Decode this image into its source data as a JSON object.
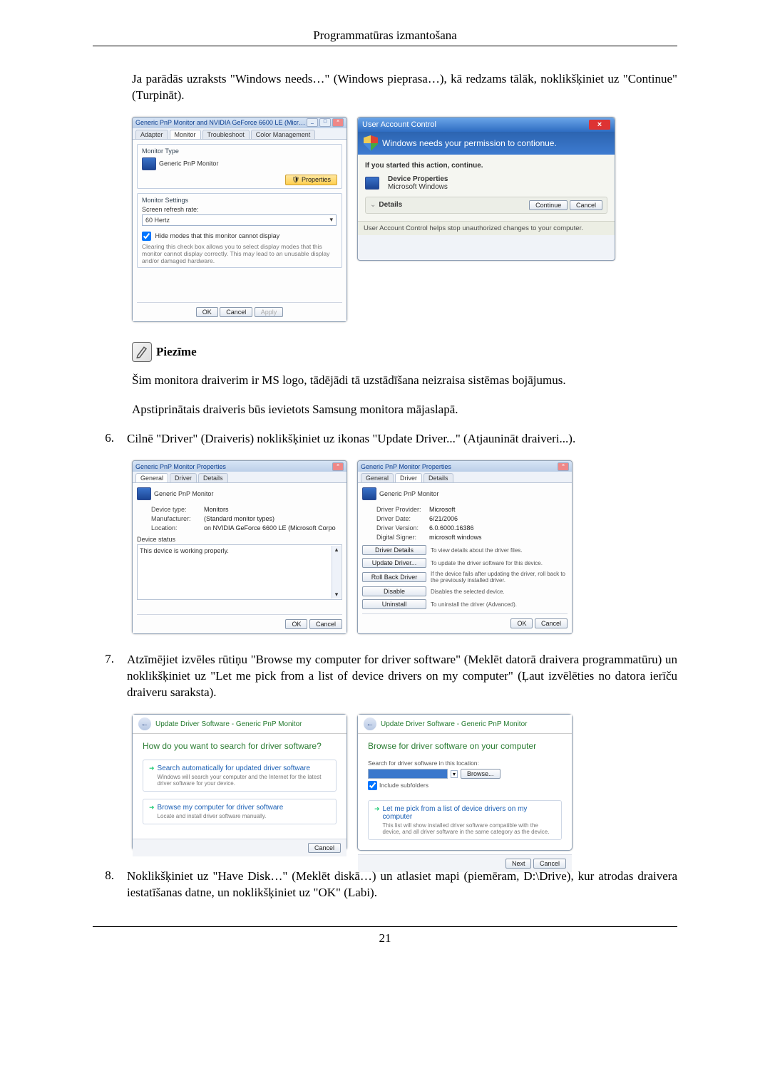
{
  "header": {
    "title": "Programmatūras izmantošana"
  },
  "intro": "Ja parādās uzraksts \"Windows needs…\" (Windows pieprasa…), kā redzams tālāk, noklikšķiniet uz \"Continue\" (Turpināt).",
  "monitorSettings": {
    "title": "Generic PnP Monitor and NVIDIA GeForce 6600 LE (Microsoft Co...",
    "tabs": [
      "Adapter",
      "Monitor",
      "Troubleshoot",
      "Color Management"
    ],
    "activeTab": "Monitor",
    "typeGroup": "Monitor Type",
    "deviceName": "Generic PnP Monitor",
    "propertiesBtn": "Properties",
    "settingsGroup": "Monitor Settings",
    "refreshLabel": "Screen refresh rate:",
    "refreshValue": "60 Hertz",
    "hideModesLabel": "Hide modes that this monitor cannot display",
    "hideModesHelp": "Clearing this check box allows you to select display modes that this monitor cannot display correctly. This may lead to an unusable display and/or damaged hardware.",
    "ok": "OK",
    "cancel": "Cancel",
    "apply": "Apply"
  },
  "uac": {
    "windowTitle": "User Account Control",
    "headerText": "Windows needs your permission to contionue.",
    "ifStarted": "If you started this action, continue.",
    "line1": "Device Properties",
    "line2": "Microsoft Windows",
    "details": "Details",
    "continue": "Continue",
    "cancel": "Cancel",
    "footer": "User Account Control helps stop unauthorized changes to your computer."
  },
  "note": {
    "label": "Piezīme",
    "p1": "Šim monitora draiverim ir MS logo, tādējādi tā uzstādīšana neizraisa sistēmas bojājumus.",
    "p2": "Apstiprinātais draiveris būs ievietots Samsung monitora mājaslapā."
  },
  "step6": {
    "num": "6.",
    "text": "Cilnē \"Driver\" (Draiveris) noklikšķiniet uz ikonas \"Update Driver...\" (Atjaunināt draiveri...)."
  },
  "propsGeneral": {
    "title": "Generic PnP Monitor Properties",
    "tabs": [
      "General",
      "Driver",
      "Details"
    ],
    "active": "General",
    "name": "Generic PnP Monitor",
    "rows": [
      {
        "k": "Device type:",
        "v": "Monitors"
      },
      {
        "k": "Manufacturer:",
        "v": "(Standard monitor types)"
      },
      {
        "k": "Location:",
        "v": "on NVIDIA GeForce 6600 LE (Microsoft Corpo"
      }
    ],
    "statusLabel": "Device status",
    "statusText": "This device is working properly.",
    "ok": "OK",
    "cancel": "Cancel"
  },
  "propsDriver": {
    "title": "Generic PnP Monitor Properties",
    "tabs": [
      "General",
      "Driver",
      "Details"
    ],
    "active": "Driver",
    "name": "Generic PnP Monitor",
    "rows": [
      {
        "k": "Driver Provider:",
        "v": "Microsoft"
      },
      {
        "k": "Driver Date:",
        "v": "6/21/2006"
      },
      {
        "k": "Driver Version:",
        "v": "6.0.6000.16386"
      },
      {
        "k": "Digital Signer:",
        "v": "microsoft windows"
      }
    ],
    "btnDetails": "Driver Details",
    "btnDetailsTxt": "To view details about the driver files.",
    "btnUpdate": "Update Driver...",
    "btnUpdateTxt": "To update the driver software for this device.",
    "btnRollback": "Roll Back Driver",
    "btnRollbackTxt": "If the device fails after updating the driver, roll back to the previously installed driver.",
    "btnDisable": "Disable",
    "btnDisableTxt": "Disables the selected device.",
    "btnUninstall": "Uninstall",
    "btnUninstallTxt": "To uninstall the driver (Advanced).",
    "ok": "OK",
    "cancel": "Cancel"
  },
  "step7": {
    "num": "7.",
    "text": "Atzīmējiet izvēles rūtiņu \"Browse my computer for driver software\" (Meklēt datorā draivera programmatūru) un noklikšķiniet uz \"Let me pick from a list of device drivers on my computer\" (Ļaut izvēlēties no datora ierīču draiveru saraksta)."
  },
  "wizard1": {
    "breadcrumb": "Update Driver Software - Generic PnP Monitor",
    "question": "How do you want to search for driver software?",
    "opt1Title": "Search automatically for updated driver software",
    "opt1Sub": "Windows will search your computer and the Internet for the latest driver software for your device.",
    "opt2Title": "Browse my computer for driver software",
    "opt2Sub": "Locate and install driver software manually.",
    "cancel": "Cancel"
  },
  "wizard2": {
    "breadcrumb": "Update Driver Software - Generic PnP Monitor",
    "heading": "Browse for driver software on your computer",
    "searchLabel": "Search for driver software in this location:",
    "browse": "Browse...",
    "includeSub": "Include subfolders",
    "optTitle": "Let me pick from a list of device drivers on my computer",
    "optSub": "This list will show installed driver software compatible with the device, and all driver software in the same category as the device.",
    "next": "Next",
    "cancel": "Cancel"
  },
  "step8": {
    "num": "8.",
    "text": "Noklikšķiniet uz \"Have Disk…\" (Meklēt diskā…) un atlasiet mapi (piemēram, D:\\Drive), kur atrodas draivera iestatīšanas datne, un noklikšķiniet uz \"OK\" (Labi)."
  },
  "pageNumber": "21"
}
